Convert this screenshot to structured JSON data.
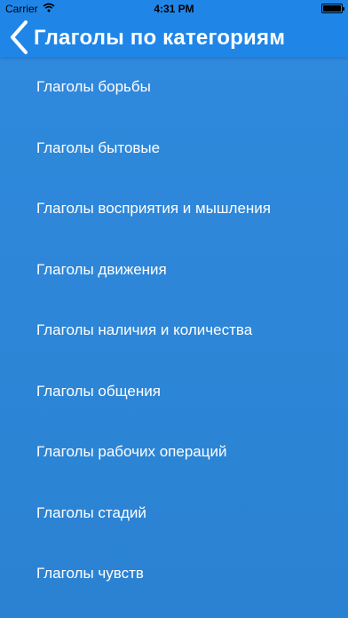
{
  "status_bar": {
    "carrier": "Carrier",
    "time": "4:31 PM",
    "battery_level": 1.0,
    "icons": [
      "wifi-icon",
      "battery-icon"
    ]
  },
  "nav": {
    "back_icon": "chevron-left-icon",
    "title": "Глаголы по категориям"
  },
  "categories": [
    {
      "label": "Глаголы борьбы"
    },
    {
      "label": "Глаголы бытовые"
    },
    {
      "label": "Глаголы восприятия и мышления"
    },
    {
      "label": "Глаголы движения"
    },
    {
      "label": "Глаголы наличия и количества"
    },
    {
      "label": "Глаголы общения"
    },
    {
      "label": "Глаголы рабочих операций"
    },
    {
      "label": "Глаголы стадий"
    },
    {
      "label": "Глаголы чувств"
    }
  ],
  "colors": {
    "nav_background": "#1f86e8",
    "list_background": "#2f86d6",
    "text": "#ffffff"
  }
}
